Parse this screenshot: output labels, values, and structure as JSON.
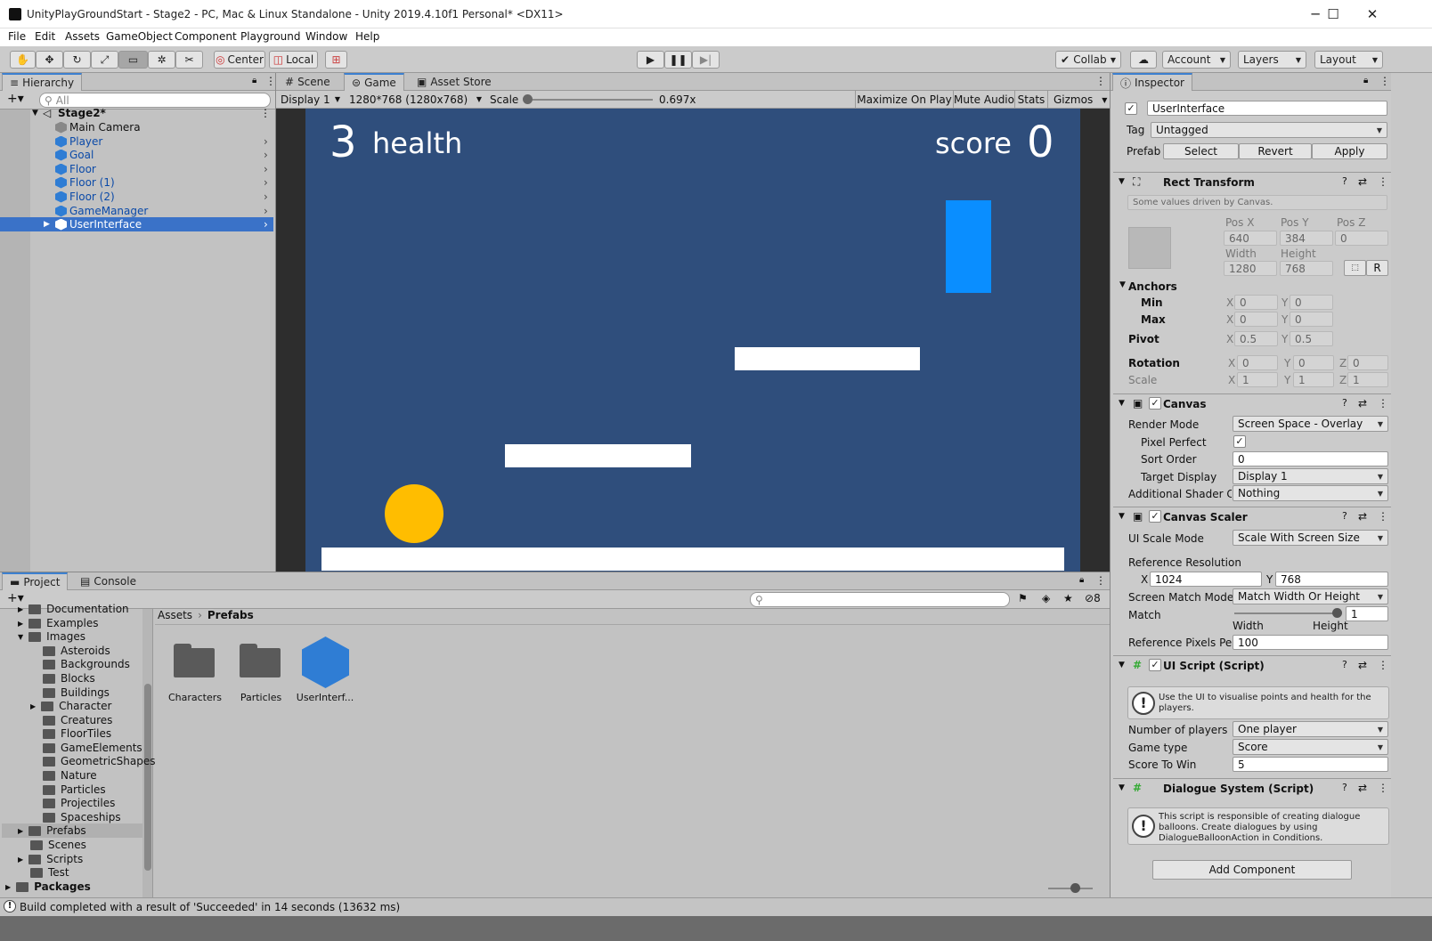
{
  "window": {
    "title": "UnityPlayGroundStart - Stage2 - PC, Mac & Linux Standalone - Unity 2019.4.10f1 Personal* <DX11>",
    "controls": [
      "─",
      "☐",
      "✕"
    ]
  },
  "menu": [
    "File",
    "Edit",
    "Assets",
    "GameObject",
    "Component",
    "Playground",
    "Window",
    "Help"
  ],
  "toolbar": {
    "center": "Center",
    "local": "Local",
    "collab": "Collab",
    "account": "Account",
    "layers": "Layers",
    "layout": "Layout"
  },
  "hierarchy": {
    "tab": "Hierarchy",
    "search_placeholder": "All",
    "scene": "Stage2*",
    "items": [
      "Main Camera",
      "Player",
      "Goal",
      "Floor",
      "Floor (1)",
      "Floor (2)",
      "GameManager",
      "UserInterface"
    ],
    "selected": "UserInterface"
  },
  "game": {
    "tabs": [
      "Scene",
      "Game",
      "Asset Store"
    ],
    "display": "Display 1",
    "resolution": "1280*768 (1280x768)",
    "scale_label": "Scale",
    "scale_value": "0.697x",
    "buttons": [
      "Maximize On Play",
      "Mute Audio",
      "Stats",
      "Gizmos"
    ],
    "health_value": "3",
    "health_label": "health",
    "score_label": "score",
    "score_value": "0",
    "colors": {
      "bg": "#2f4e7c",
      "goal": "#0a8eff",
      "player": "#ffbd00",
      "platform": "#ffffff"
    }
  },
  "project": {
    "tabs": [
      "Project",
      "Console"
    ],
    "filter_count": "8",
    "breadcrumb": [
      "Assets",
      "Prefabs"
    ],
    "tree": [
      "Documentation",
      "Examples",
      "Images",
      "Asteroids",
      "Backgrounds",
      "Blocks",
      "Buildings",
      "Character",
      "Creatures",
      "FloorTiles",
      "GameElements",
      "GeometricShapes",
      "Nature",
      "Particles",
      "Projectiles",
      "Spaceships",
      "Prefabs",
      "Scenes",
      "Scripts",
      "Test",
      "Packages"
    ],
    "assets": [
      "Characters",
      "Particles",
      "UserInterf..."
    ]
  },
  "inspector": {
    "tab": "Inspector",
    "object_name": "UserInterface",
    "tag_label": "Tag",
    "tag_value": "Untagged",
    "prefab_label": "Prefab",
    "prefab_buttons": [
      "Select",
      "Revert",
      "Apply"
    ],
    "rect_transform": {
      "title": "Rect Transform",
      "note": "Some values driven by Canvas.",
      "pos_x_label": "Pos X",
      "pos_y_label": "Pos Y",
      "pos_z_label": "Pos Z",
      "pos_x": "640",
      "pos_y": "384",
      "pos_z": "0",
      "width_label": "Width",
      "height_label": "Height",
      "width": "1280",
      "height": "768",
      "r_button": "R",
      "anchors": "Anchors",
      "min": "Min",
      "max": "Max",
      "min_x": "0",
      "min_y": "0",
      "max_x": "0",
      "max_y": "0",
      "pivot": "Pivot",
      "pivot_x": "0.5",
      "pivot_y": "0.5",
      "rotation": "Rotation",
      "rot_x": "0",
      "rot_y": "0",
      "rot_z": "0",
      "scale": "Scale",
      "scale_x": "1",
      "scale_y": "1",
      "scale_z": "1",
      "x": "X",
      "y": "Y",
      "z": "Z"
    },
    "canvas": {
      "title": "Canvas",
      "render_mode_label": "Render Mode",
      "render_mode": "Screen Space - Overlay",
      "pixel_perfect_label": "Pixel Perfect",
      "sort_order_label": "Sort Order",
      "sort_order": "0",
      "target_display_label": "Target Display",
      "target_display": "Display 1",
      "shader_label": "Additional Shader Ch",
      "shader": "Nothing"
    },
    "canvas_scaler": {
      "title": "Canvas Scaler",
      "ui_scale_label": "UI Scale Mode",
      "ui_scale": "Scale With Screen Size",
      "ref_res_label": "Reference Resolution",
      "ref_x": "1024",
      "ref_y": "768",
      "match_mode_label": "Screen Match Mode",
      "match_mode": "Match Width Or Height",
      "match_label": "Match",
      "match_value": "1",
      "match_fraction": 1,
      "width_word": "Width",
      "height_word": "Height",
      "ppu_label": "Reference Pixels Per",
      "ppu": "100"
    },
    "ui_script": {
      "title": "UI Script (Script)",
      "help": "Use the UI to visualise points and health for the players.",
      "players_label": "Number of players",
      "players": "One player",
      "game_type_label": "Game type",
      "game_type": "Score",
      "score_to_win_label": "Score To Win",
      "score_to_win": "5"
    },
    "dialogue": {
      "title": "Dialogue System (Script)",
      "help": "This script is responsible of creating dialogue balloons. Create dialogues by using DialogueBalloonAction in Conditions."
    },
    "add_component": "Add Component"
  },
  "status": "Build completed with a result of 'Succeeded' in 14 seconds (13632 ms)"
}
